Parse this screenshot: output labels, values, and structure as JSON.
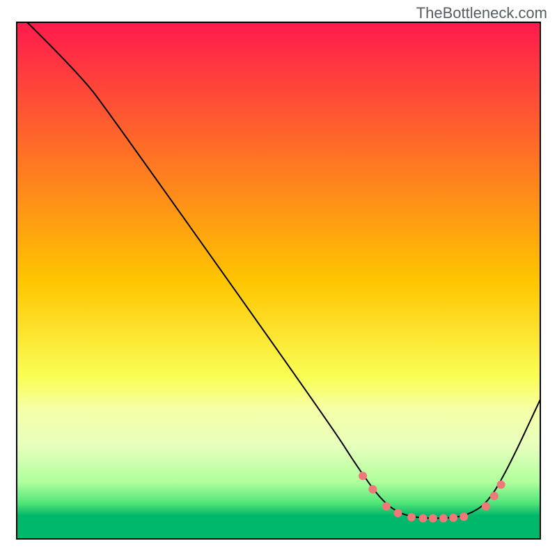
{
  "attribution": "TheBottleneck.com",
  "chart_data": {
    "type": "line",
    "title": "",
    "xlabel": "",
    "ylabel": "",
    "xlim": [
      0,
      100
    ],
    "ylim": [
      0,
      100
    ],
    "background": {
      "type": "vertical-gradient",
      "stops": [
        {
          "offset": 0,
          "color": "#ff1a4d"
        },
        {
          "offset": 50,
          "color": "#ffc500"
        },
        {
          "offset": 69,
          "color": "#f9ff57"
        },
        {
          "offset": 75,
          "color": "#f6ffa8"
        },
        {
          "offset": 82,
          "color": "#e7ffbd"
        },
        {
          "offset": 89,
          "color": "#b0ff9c"
        },
        {
          "offset": 93,
          "color": "#52e67a"
        },
        {
          "offset": 94.5,
          "color": "#24c96e"
        },
        {
          "offset": 95.5,
          "color": "#00b86a"
        },
        {
          "offset": 100,
          "color": "#00b86a"
        }
      ]
    },
    "curve": {
      "color": "#000000",
      "width": 2,
      "points": [
        {
          "x": 2,
          "y": 100
        },
        {
          "x": 12,
          "y": 90
        },
        {
          "x": 18,
          "y": 82
        },
        {
          "x": 60,
          "y": 22
        },
        {
          "x": 65,
          "y": 14
        },
        {
          "x": 70,
          "y": 7
        },
        {
          "x": 74,
          "y": 4.5
        },
        {
          "x": 78,
          "y": 4
        },
        {
          "x": 82,
          "y": 4
        },
        {
          "x": 86,
          "y": 4.5
        },
        {
          "x": 90,
          "y": 7
        },
        {
          "x": 94,
          "y": 14
        },
        {
          "x": 100,
          "y": 27
        }
      ]
    },
    "markers": {
      "color": "#f07878",
      "radius": 6,
      "points": [
        {
          "x": 66.1,
          "y": 12.2
        },
        {
          "x": 68.0,
          "y": 9.6
        },
        {
          "x": 70.6,
          "y": 6.3
        },
        {
          "x": 72.8,
          "y": 5.0
        },
        {
          "x": 75.4,
          "y": 4.2
        },
        {
          "x": 77.6,
          "y": 4.0
        },
        {
          "x": 79.5,
          "y": 4.0
        },
        {
          "x": 81.5,
          "y": 4.0
        },
        {
          "x": 83.4,
          "y": 4.1
        },
        {
          "x": 85.4,
          "y": 4.3
        },
        {
          "x": 89.6,
          "y": 6.3
        },
        {
          "x": 91.2,
          "y": 8.3
        },
        {
          "x": 92.5,
          "y": 10.5
        }
      ]
    }
  }
}
